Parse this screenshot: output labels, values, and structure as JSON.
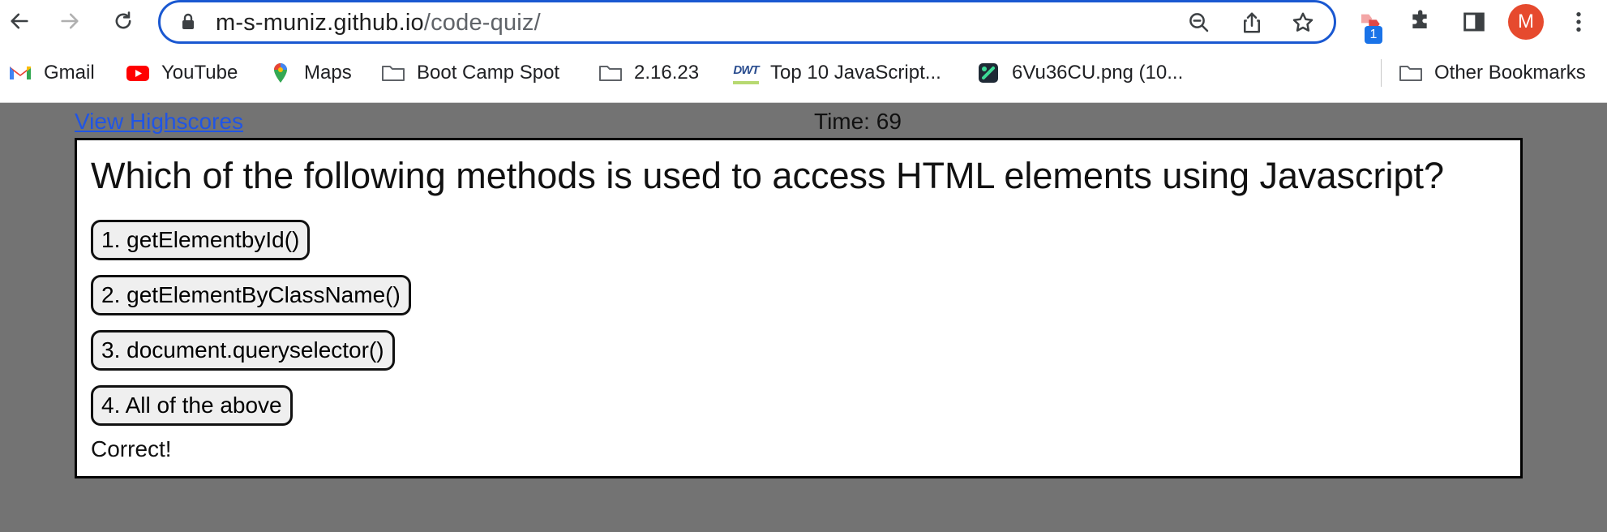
{
  "browser": {
    "url_host": "m-s-muniz.github.io",
    "url_path": "/code-quiz/",
    "extension_badge": "1",
    "avatar_letter": "M",
    "colors": {
      "omnibox_border": "#1a58d1",
      "avatar": "#e64a2e",
      "badge": "#1a73e8"
    }
  },
  "bookmarks": {
    "items": [
      {
        "label": "Gmail",
        "icon": "gmail-icon"
      },
      {
        "label": "YouTube",
        "icon": "youtube-icon"
      },
      {
        "label": "Maps",
        "icon": "maps-icon"
      },
      {
        "label": "Boot Camp Spot",
        "icon": "folder-icon"
      },
      {
        "label": "2.16.23",
        "icon": "folder-icon"
      },
      {
        "label": "Top 10 JavaScript...",
        "icon": "dwt-icon",
        "icon_text": "DWT"
      },
      {
        "label": "6Vu36CU.png (10...",
        "icon": "image-ext-icon"
      }
    ],
    "other": {
      "label": "Other Bookmarks",
      "icon": "folder-icon"
    }
  },
  "page": {
    "highscores_link": "View Highscores",
    "timer": "Time: 69",
    "question": "Which of the following methods is used to access HTML elements using Javascript?",
    "answers": [
      "1. getElementbyId()",
      "2. getElementByClassName()",
      "3. document.queryselector()",
      "4. All of the above"
    ],
    "result": "Correct!",
    "colors": {
      "background": "#737373",
      "link": "#2055e5"
    }
  }
}
